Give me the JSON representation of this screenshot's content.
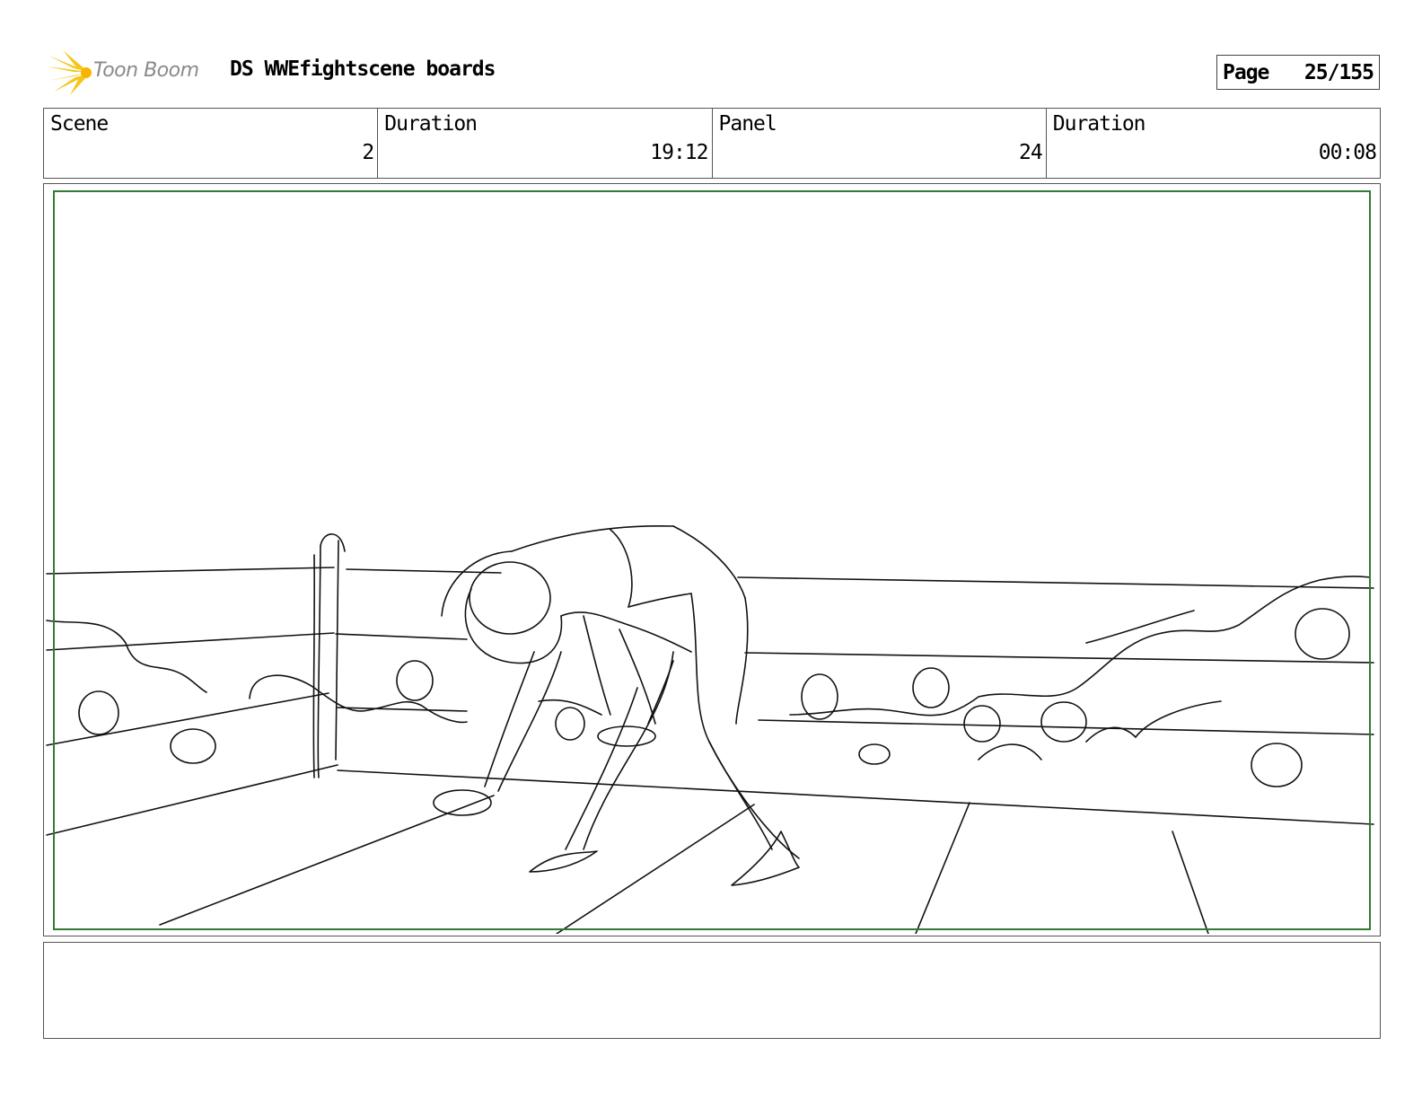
{
  "header": {
    "brand": "Toon Boom",
    "title": "DS WWEfightscene boards",
    "page_label": "Page",
    "page_number": "25/155"
  },
  "meta": {
    "scene_label": "Scene",
    "scene_value": "2",
    "scene_duration_label": "Duration",
    "scene_duration_value": "19:12",
    "panel_label": "Panel",
    "panel_value": "24",
    "panel_duration_label": "Duration",
    "panel_duration_value": "00:08"
  },
  "colors": {
    "safe_area": "#2f7d32",
    "logo_burst": "#f5c518",
    "border": "#555555"
  }
}
